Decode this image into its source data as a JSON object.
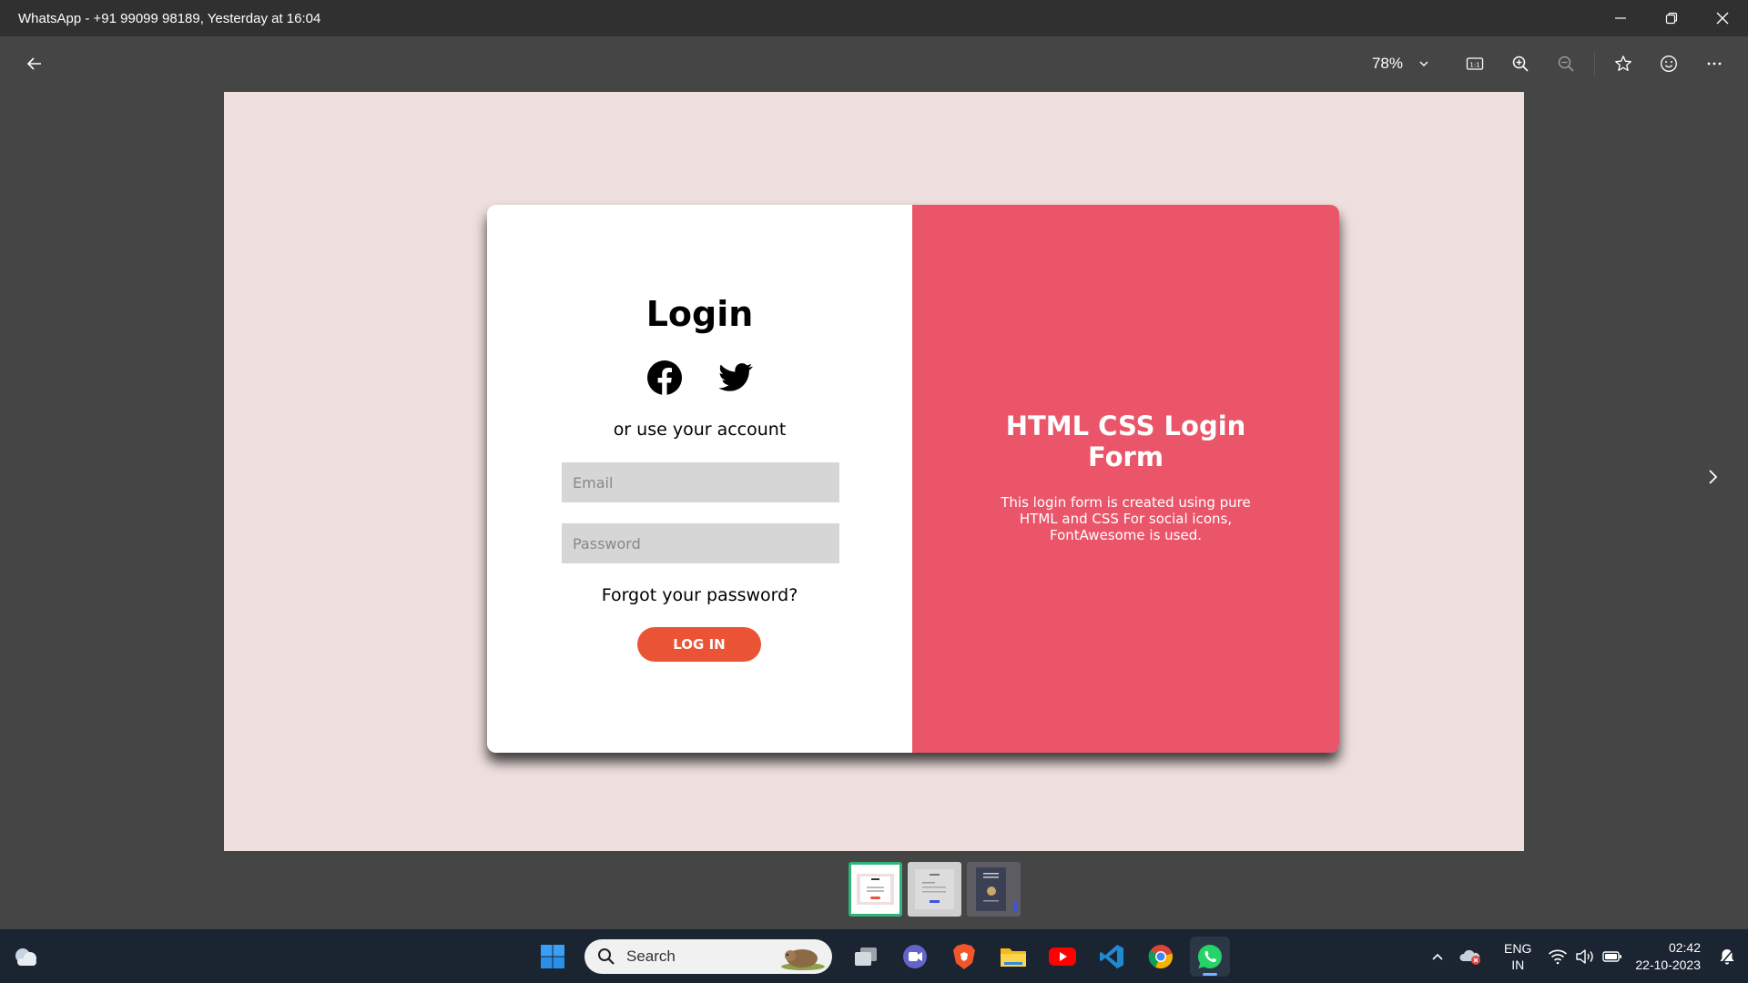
{
  "window": {
    "title": "WhatsApp - +91 99099 98189, Yesterday at 16:04"
  },
  "toolbar": {
    "zoom_level": "78%",
    "icons": [
      "back-arrow-icon",
      "chevron-down-icon",
      "actual-size-icon",
      "zoom-in-icon",
      "zoom-out-icon",
      "star-icon",
      "smiley-icon",
      "more-icon"
    ]
  },
  "login_form": {
    "title": "Login",
    "or_text": "or use your account",
    "email_placeholder": "Email",
    "password_placeholder": "Password",
    "forgot_text": "Forgot your password?",
    "login_button": "LOG IN",
    "panel_title": "HTML CSS Login Form",
    "panel_desc": "This login form is created using pure HTML and CSS For social icons, FontAwesome is used.",
    "colors": {
      "accent": "#ea5569",
      "button": "#ea5434",
      "page_bg": "#efe0df"
    }
  },
  "taskbar": {
    "search_label": "Search",
    "lang_line1": "ENG",
    "lang_line2": "IN",
    "time": "02:42",
    "date": "22-10-2023",
    "apps": [
      "windows-start-icon",
      "task-view-icon",
      "teams-chat-icon",
      "brave-browser-icon",
      "file-explorer-icon",
      "youtube-icon",
      "vscode-icon",
      "chrome-icon",
      "whatsapp-icon"
    ]
  }
}
